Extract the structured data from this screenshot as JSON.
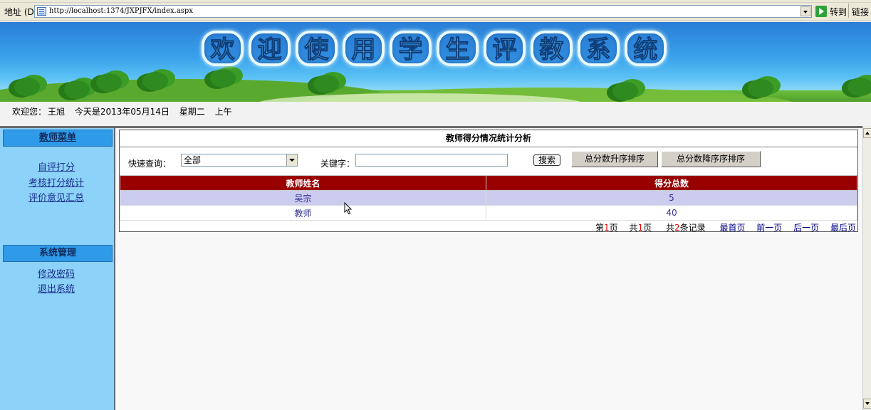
{
  "browser": {
    "address_label": "地址 (D)",
    "url": "http://localhost:1374/JXPJFX/index.aspx",
    "go_label": "转到",
    "links_label": "链接"
  },
  "banner": {
    "title_chars": [
      "欢",
      "迎",
      "使",
      "用",
      "学",
      "生",
      "评",
      "教",
      "系",
      "统"
    ]
  },
  "welcome": {
    "greeting": "欢迎您：",
    "user": "王旭",
    "date": "今天是2013年05月14日",
    "weekday": "星期二",
    "period": "上午"
  },
  "sidebar": {
    "teacher_menu_title": "教师菜单",
    "teacher_items": [
      "自评打分",
      "考核打分统计",
      "评价意见汇总"
    ],
    "system_menu_title": "系统管理",
    "system_items": [
      "修改密码",
      "退出系统"
    ]
  },
  "panel": {
    "title": "教师得分情况统计分析",
    "quick_query_label": "快速查询：",
    "quick_query_value": "全部",
    "keyword_label": "关键字：",
    "keyword_value": "",
    "search_button": "搜索",
    "sort_asc_button": "总分数升序排序",
    "sort_desc_button": "总分数降序序排序",
    "columns": [
      "教师姓名",
      "得分总数"
    ],
    "rows": [
      {
        "name": "吴宗",
        "score": "5"
      },
      {
        "name": "教师",
        "score": "40"
      }
    ],
    "pager": {
      "page_prefix": "第",
      "page_num": "1",
      "page_suffix": "页",
      "total_prefix": "共",
      "total_pages": "1",
      "total_suffix": "页",
      "records_prefix": "共",
      "records_count": "2",
      "records_suffix": "条记录",
      "first": "最首页",
      "prev": "前一页",
      "next": "后一页",
      "last": "最后页"
    }
  }
}
